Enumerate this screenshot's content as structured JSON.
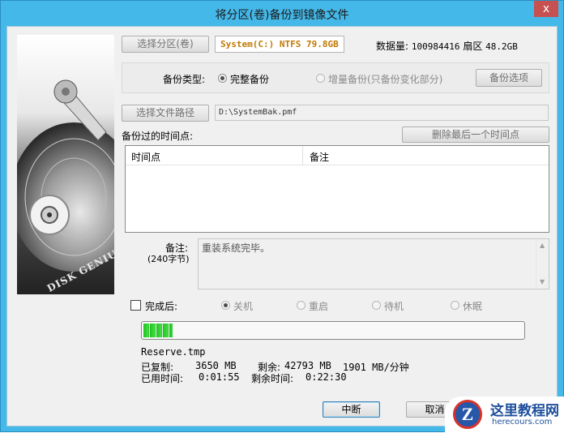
{
  "window": {
    "title": "将分区(卷)备份到镜像文件",
    "close_glyph": "x"
  },
  "partition": {
    "select_button": "选择分区(卷)",
    "selected": "System(C:) NTFS 79.8GB",
    "data_label": "数据量:",
    "data_value": "100984416",
    "sector_label": "扇区",
    "size": "48.2GB"
  },
  "backup_type": {
    "label": "备份类型:",
    "full_label": "完整备份",
    "incremental_label": "增量备份(只备份变化部分)",
    "selected": "full",
    "options_button": "备份选项"
  },
  "file": {
    "select_button": "选择文件路径",
    "path": "D:\\SystemBak.pmf"
  },
  "timepoints": {
    "label": "备份过的时间点:",
    "delete_button": "删除最后一个时间点",
    "columns": [
      "时间点",
      "备注"
    ],
    "rows": []
  },
  "note": {
    "label": "备注:",
    "limit": "(240字节)",
    "text": "重装系统完毕。"
  },
  "after_finish": {
    "label": "完成后:",
    "checked": false,
    "options": [
      "关机",
      "重启",
      "待机",
      "休眠"
    ],
    "selected": "关机"
  },
  "progress": {
    "value_fraction": 0.08,
    "file": "Reserve.tmp",
    "copied_label": "已复制:",
    "copied_value": "3650 MB",
    "remaining_label": "剩余:",
    "remaining_value": "42793 MB",
    "speed": "1901 MB/分钟",
    "elapsed_label": "已用时间:",
    "elapsed_value": "0:01:55",
    "remain_time_label": "剩余时间:",
    "remain_time_value": "0:22:30"
  },
  "buttons": {
    "abort": "中断",
    "cancel": "取消"
  },
  "side_image": {
    "text": "DISK GENIUS"
  },
  "watermark": {
    "logo": "Z",
    "title": "这里教程网",
    "subtitle": "herecours.com"
  },
  "colors": {
    "accent": "#44b8e8",
    "progress": "#22c122",
    "partition_text": "#c07800"
  }
}
